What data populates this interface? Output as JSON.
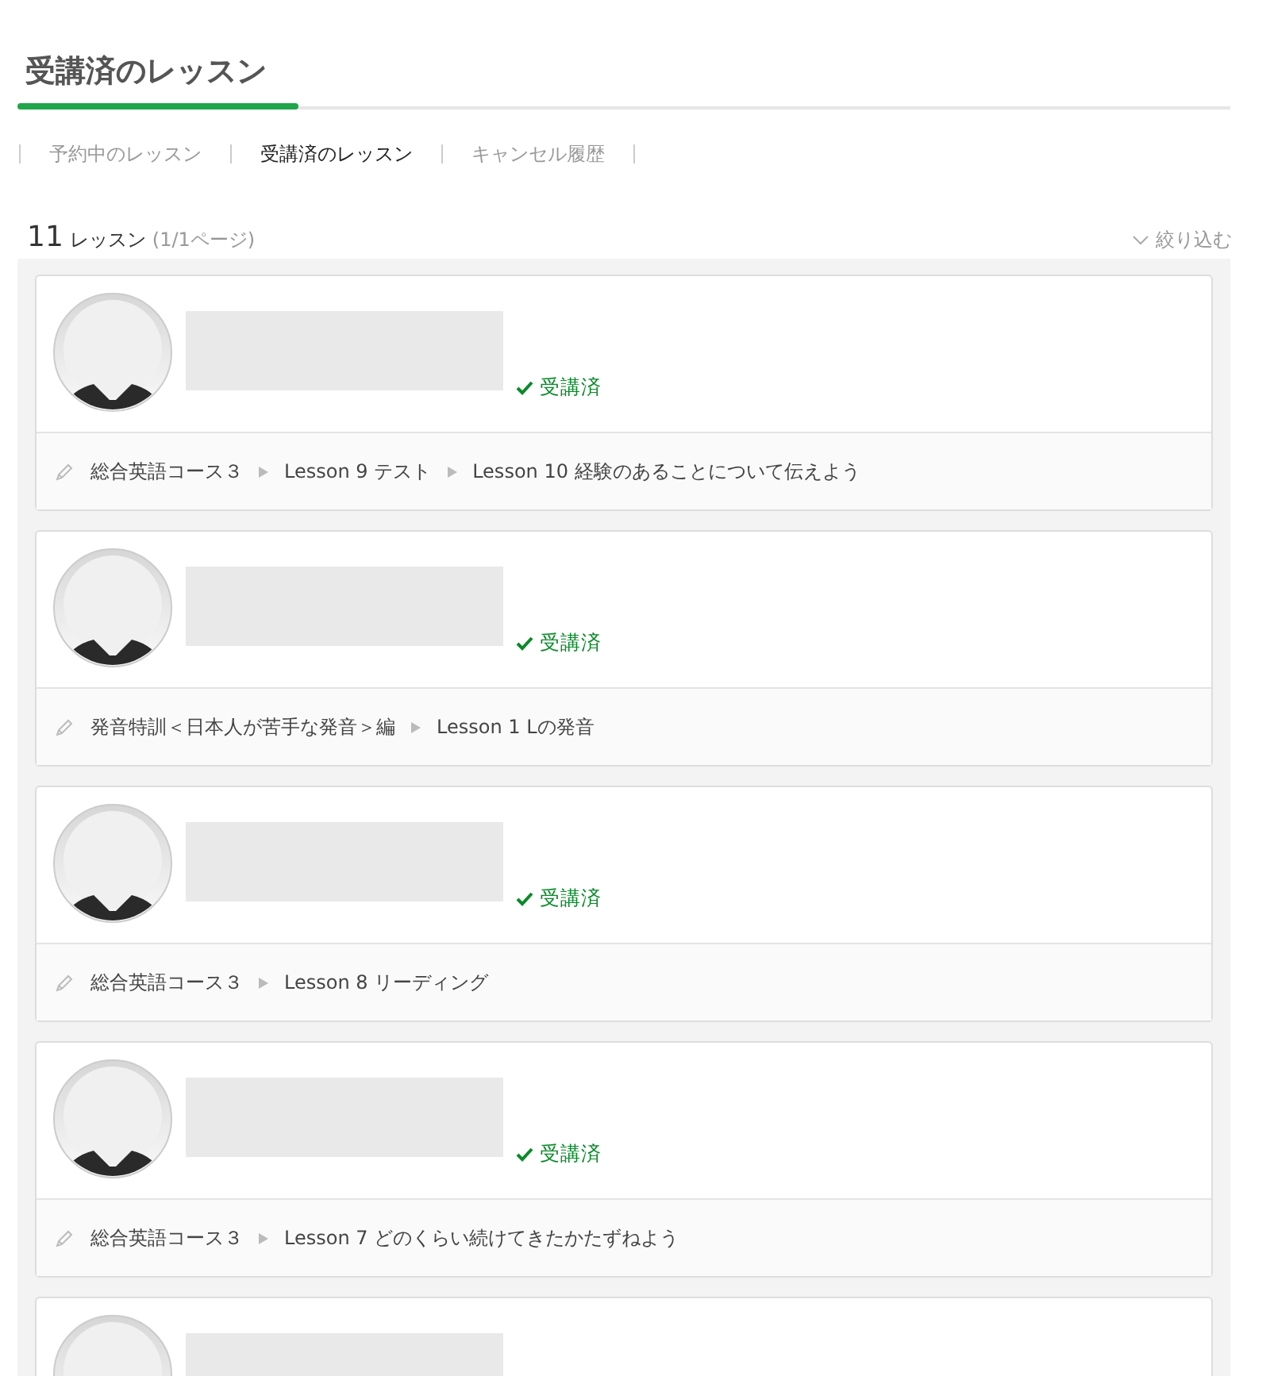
{
  "title": "受講済のレッスン",
  "tabs": [
    {
      "label": "予約中のレッスン",
      "selected": false
    },
    {
      "label": "受講済のレッスン",
      "selected": true
    },
    {
      "label": "キャンセル履歴",
      "selected": false
    }
  ],
  "summary": {
    "count": "11",
    "unit": "レッスン",
    "pages": "(1/1ページ)"
  },
  "filter": {
    "label": "絞り込む"
  },
  "lessons": [
    {
      "kind": "full",
      "status": "受講済",
      "path": [
        "総合英語コース３",
        "Lesson 9 テスト",
        "Lesson 10 経験のあることについて伝えよう"
      ]
    },
    {
      "kind": "full",
      "status": "受講済",
      "path": [
        "発音特訓＜日本人が苦手な発音＞編",
        "Lesson 1 Lの発音"
      ]
    },
    {
      "kind": "full",
      "status": "受講済",
      "path": [
        "総合英語コース３",
        "Lesson 8 リーディング"
      ]
    },
    {
      "kind": "full",
      "status": "受講済",
      "path": [
        "総合英語コース３",
        "Lesson 7 どのくらい続けてきたかたずねよう"
      ]
    },
    {
      "kind": "cut-off"
    }
  ]
}
